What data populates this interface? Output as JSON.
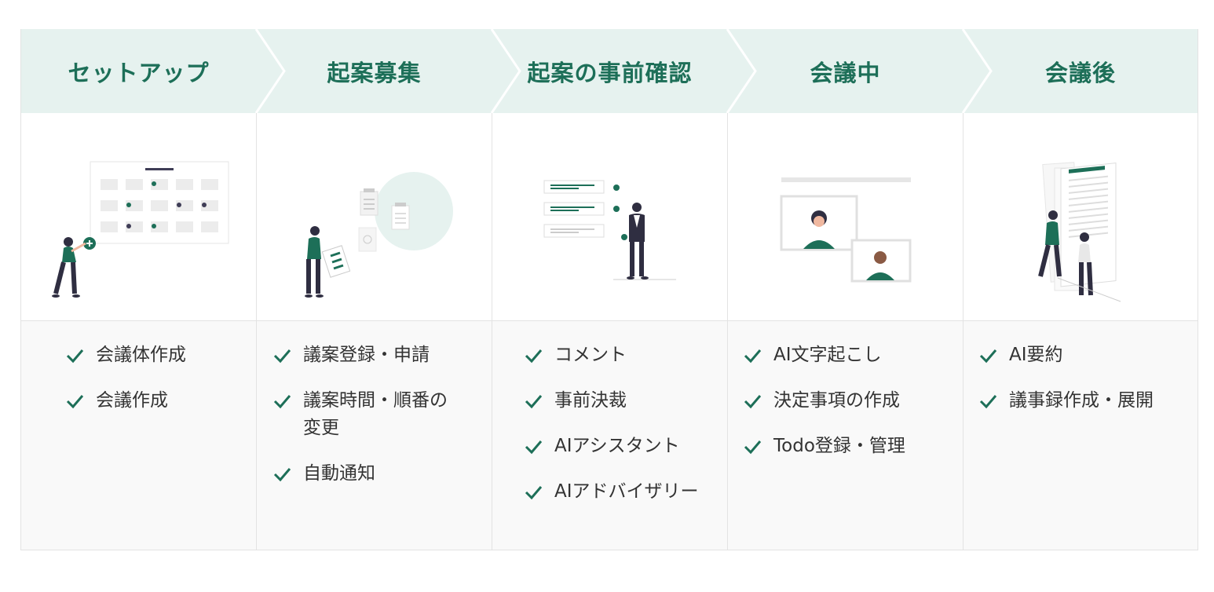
{
  "steps": [
    {
      "title": "セットアップ",
      "items": [
        "会議体作成",
        "会議作成"
      ]
    },
    {
      "title": "起案募集",
      "items": [
        "議案登録・申請",
        "議案時間・順番の変更",
        "自動通知"
      ]
    },
    {
      "title": "起案の事前確認",
      "items": [
        "コメント",
        "事前決裁",
        "AIアシスタント",
        "AIアドバイザリー"
      ]
    },
    {
      "title": "会議中",
      "items": [
        "AI文字起こし",
        "決定事項の作成",
        "Todo登録・管理"
      ]
    },
    {
      "title": "会議後",
      "items": [
        "AI要約",
        "議事録作成・展開"
      ]
    }
  ],
  "colors": {
    "header_bg": "#e6f2ef",
    "accent": "#1d6f58",
    "list_bg": "#f9f9f9"
  },
  "icons": [
    "check-icon",
    "chevron-right-icon"
  ]
}
